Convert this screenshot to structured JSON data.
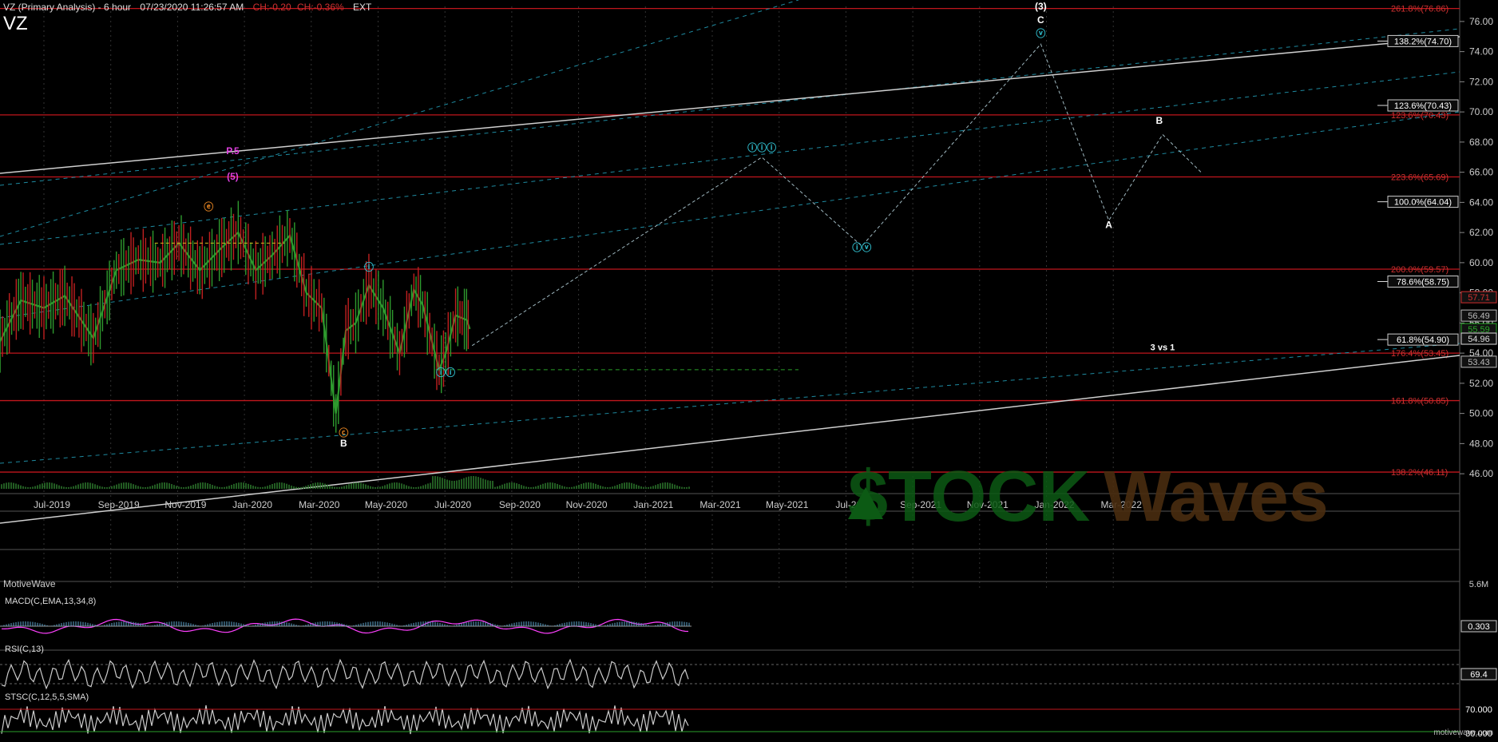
{
  "header": {
    "title": "VZ (Primary Analysis) - 6 hour",
    "datetime": "07/23/2020 11:26:57 AM",
    "change": "CH:-0.20",
    "change_pct": "CH:-0.36%",
    "ext": "EXT",
    "symbol": "VZ"
  },
  "footer_brand": "MotiveWave",
  "watermark_url": "motivewave.com",
  "stockwaves_logo": {
    "stock": "$TOCK",
    "waves": "Waves"
  },
  "colors": {
    "fib_line": "#c0161c",
    "trend_line": "#cfcfcf",
    "channel": "#1e8aa0",
    "price_up": "#2e9a2e",
    "price_down": "#c02020",
    "macd": "#ff40ff",
    "histogram": "#5fa8d0"
  },
  "chart_data": [
    {
      "type": "line",
      "title": "VZ (Primary Analysis) - 6 hour",
      "ylim": [
        45,
        77
      ],
      "x_tick_labels": [
        "Jul-2019",
        "Sep-2019",
        "Nov-2019",
        "Jan-2020",
        "Mar-2020",
        "May-2020",
        "Jul-2020",
        "Sep-2020",
        "Nov-2020",
        "Jan-2021",
        "Mar-2021",
        "May-2021",
        "Jul-2021",
        "Sep-2021",
        "Nov-2021",
        "Jan-2022",
        "Mar-2022"
      ],
      "y_tick_labels": [
        "76.00",
        "74.00",
        "72.00",
        "70.00",
        "68.00",
        "66.00",
        "64.00",
        "62.00",
        "60.00",
        "58.00",
        "56.00",
        "54.00",
        "52.00",
        "50.00",
        "48.00",
        "46.00"
      ],
      "price_series": {
        "x_dates": [
          "2019-05-20",
          "2019-06-10",
          "2019-07-01",
          "2019-07-20",
          "2019-08-15",
          "2019-09-05",
          "2019-09-25",
          "2019-10-15",
          "2019-11-01",
          "2019-11-20",
          "2019-12-10",
          "2019-12-25",
          "2020-01-10",
          "2020-01-25",
          "2020-02-10",
          "2020-02-25",
          "2020-03-10",
          "2020-03-23",
          "2020-04-01",
          "2020-04-10",
          "2020-04-22",
          "2020-05-05",
          "2020-05-20",
          "2020-06-02",
          "2020-06-10",
          "2020-06-25",
          "2020-07-01",
          "2020-07-10",
          "2020-07-20",
          "2020-07-23"
        ],
        "values": [
          54.5,
          57.5,
          57.0,
          57.8,
          55.0,
          59.5,
          60.2,
          60.0,
          61.3,
          59.5,
          61.0,
          62.0,
          59.5,
          60.5,
          61.8,
          58.0,
          57.0,
          50.0,
          55.5,
          56.0,
          58.5,
          57.0,
          54.0,
          58.2,
          57.2,
          52.9,
          54.0,
          56.5,
          56.2,
          55.6
        ]
      },
      "horizontal_levels": [
        {
          "label": "261.8%(76.86)",
          "value": 76.86
        },
        {
          "label": "123.6%(70.43)",
          "value": 69.8
        },
        {
          "label": "223.6%(65.69)",
          "value": 65.69
        },
        {
          "label": "200.0%(59.57)",
          "value": 59.57
        },
        {
          "label": "176.4%(53.45)",
          "value": 54.0
        },
        {
          "label": "161.8%(50.85)",
          "value": 50.85
        },
        {
          "label": "138.2%(46.11)",
          "value": 46.11
        }
      ],
      "fib_boxes": [
        {
          "label": "138.2%(74.70)",
          "value": 74.7
        },
        {
          "label": "123.6%(70.43)",
          "value": 70.43
        },
        {
          "label": "100.0%(64.04)",
          "value": 64.04
        },
        {
          "label": "78.6%(58.75)",
          "value": 58.75
        },
        {
          "label": "61.8%(54.90)",
          "value": 54.9
        }
      ],
      "right_axis_price_labels": [
        {
          "label": "57.71",
          "value": 57.71,
          "color": "#d23030"
        },
        {
          "label": "56.49",
          "value": 56.49,
          "color": "#bbbbbb"
        },
        {
          "label": "55.59",
          "value": 55.59,
          "color": "#26a826"
        },
        {
          "label": "54.96",
          "value": 54.96,
          "color": "#dddddd"
        },
        {
          "label": "53.43",
          "value": 53.43,
          "color": "#bbbbbb"
        }
      ],
      "projected_path": {
        "x_dates": [
          "2020-07-25",
          "2021-04-15",
          "2021-07-15",
          "2021-12-25",
          "2022-02-25",
          "2022-04-15",
          "2022-05-20"
        ],
        "values": [
          54.5,
          67.0,
          61.1,
          74.5,
          62.8,
          68.5,
          66.0
        ]
      },
      "wave_labels": [
        {
          "label": "P.5",
          "date": "2019-12-20",
          "value": 67.2,
          "color": "#e040e0"
        },
        {
          "label": "(5)",
          "date": "2019-12-20",
          "value": 65.5,
          "color": "#e040e0"
        },
        {
          "label": "ⓔ",
          "date": "2019-11-28",
          "value": 63.5,
          "color": "#e08020"
        },
        {
          "label": "ⓘ",
          "date": "2020-04-22",
          "value": 59.5,
          "color": "#30c0d0"
        },
        {
          "label": "ⓒ",
          "date": "2020-03-30",
          "value": 48.5,
          "color": "#e08020"
        },
        {
          "label": "B",
          "date": "2020-03-30",
          "value": 47.8,
          "color": "#ffffff"
        },
        {
          "label": "ⓘⓘ",
          "date": "2020-07-01",
          "value": 52.5,
          "color": "#30c0d0"
        },
        {
          "label": "ⓘⓘⓘ",
          "date": "2021-04-15",
          "value": 67.4,
          "color": "#30c0d0"
        },
        {
          "label": "ⓘⓥ",
          "date": "2021-07-15",
          "value": 60.8,
          "color": "#30c0d0"
        },
        {
          "label": "ⓥ",
          "date": "2021-12-25",
          "value": 75.0,
          "color": "#30c0d0"
        },
        {
          "label": "C",
          "date": "2021-12-25",
          "value": 75.9,
          "color": "#ffffff"
        },
        {
          "label": "(3)",
          "date": "2021-12-25",
          "value": 76.8,
          "color": "#ffffff"
        },
        {
          "label": "A",
          "date": "2022-02-25",
          "value": 62.3,
          "color": "#ffffff"
        },
        {
          "label": "B",
          "date": "2022-04-12",
          "value": 69.2,
          "color": "#ffffff"
        },
        {
          "label": "3 vs 1",
          "date": "2022-04-15",
          "value": 54.2,
          "color": "#ffffff"
        }
      ]
    },
    {
      "type": "line",
      "title": "MACD(C,EMA,13,34,8)",
      "last_value": "0.303"
    },
    {
      "type": "line",
      "title": "RSI(C,13)",
      "last_value": "69.4"
    },
    {
      "type": "line",
      "title": "STSC(C,12,5,5,SMA)",
      "levels": [
        "70.000",
        "30.000"
      ]
    }
  ],
  "volume_label": "5.6M"
}
